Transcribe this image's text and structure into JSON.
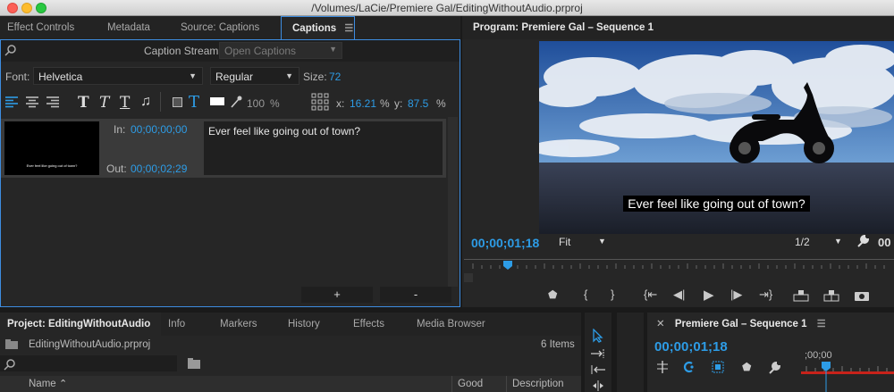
{
  "window": {
    "title": "/Volumes/LaCie/Premiere Gal/EditingWithoutAudio.prproj"
  },
  "captions_panel": {
    "tabs": [
      "Effect Controls",
      "Metadata",
      "Source: Captions",
      "Captions"
    ],
    "active_tab": "Captions",
    "caption_stream_label": "Caption Stream:",
    "caption_stream_value": "Open Captions",
    "font_label": "Font:",
    "font_value": "Helvetica",
    "style_value": "Regular",
    "size_label": "Size:",
    "size_value": "72",
    "opacity_value": "100",
    "percent": "%",
    "x_label": "x:",
    "x_value": "16.21",
    "y_label": "y:",
    "y_value": "87.5",
    "caption_item": {
      "in_label": "In:",
      "in_value": "00;00;00;00",
      "out_label": "Out:",
      "out_value": "00;00;02;29",
      "text": "Ever feel like going out of town?",
      "thumb_text": "Ever feel like going out of town?"
    },
    "add_button": "+",
    "remove_button": "-"
  },
  "program_monitor": {
    "title": "Program: Premiere Gal – Sequence 1",
    "caption_overlay": "Ever feel like going out of town?",
    "timecode": "00;00;01;18",
    "fit_value": "Fit",
    "resolution_value": "1/2",
    "end_timecode_partial": "00"
  },
  "project_panel": {
    "tabs": [
      "Project: EditingWithoutAudio",
      "Info",
      "Markers",
      "History",
      "Effects",
      "Media Browser"
    ],
    "file_name": "EditingWithoutAudio.prproj",
    "item_count": "6 Items",
    "columns": {
      "name": "Name",
      "good": "Good",
      "description": "Description"
    }
  },
  "timeline_panel": {
    "title": "Premiere Gal – Sequence 1",
    "timecode": "00;00;01;18",
    "ruler_label": ";00;00"
  },
  "colors": {
    "accent_blue": "#2d9ce6",
    "panel_bg": "#262626",
    "tab_bg": "#232323",
    "highlight": "#3d8ce0"
  }
}
